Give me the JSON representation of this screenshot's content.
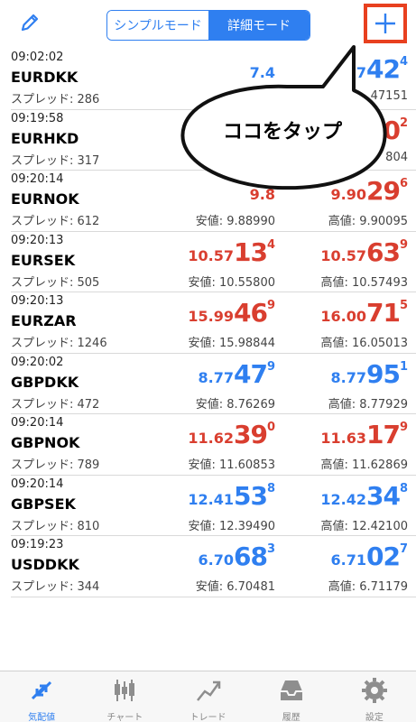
{
  "header": {
    "edit_icon": "pencil-icon",
    "mode_simple": "シンプルモード",
    "mode_detailed": "詳細モード",
    "add_icon": "plus-icon"
  },
  "callout": "ココをタップ",
  "quotes": [
    {
      "time": "09:02:02",
      "symbol": "EURDKK",
      "spread": "スプレッド: 286",
      "bid": {
        "small": "7.4",
        "big": "",
        "sup": "",
        "color": "blue"
      },
      "ask": {
        "small": "7",
        "big": "42",
        "sup": "4",
        "color": "blue"
      },
      "low": "",
      "high": "47151"
    },
    {
      "time": "09:19:58",
      "symbol": "EURHKD",
      "spread": "スプレッド: 317",
      "bid": {
        "small": "",
        "big": "",
        "sup": "",
        "color": "blue"
      },
      "ask": {
        "small": "",
        "big": "0",
        "sup": "2",
        "color": "red"
      },
      "low": "",
      "high": "804"
    },
    {
      "time": "09:20:14",
      "symbol": "EURNOK",
      "spread": "スプレッド: 612",
      "bid": {
        "small": "9.8",
        "big": "",
        "sup": "",
        "color": "red"
      },
      "ask": {
        "small": "9.90",
        "big": "29",
        "sup": "6",
        "color": "red"
      },
      "low": "安値: 9.88990",
      "high": "高値: 9.90095"
    },
    {
      "time": "09:20:13",
      "symbol": "EURSEK",
      "spread": "スプレッド: 505",
      "bid": {
        "small": "10.57",
        "big": "13",
        "sup": "4",
        "color": "red"
      },
      "ask": {
        "small": "10.57",
        "big": "63",
        "sup": "9",
        "color": "red"
      },
      "low": "安値: 10.55800",
      "high": "高値: 10.57493"
    },
    {
      "time": "09:20:13",
      "symbol": "EURZAR",
      "spread": "スプレッド: 1246",
      "bid": {
        "small": "15.99",
        "big": "46",
        "sup": "9",
        "color": "red"
      },
      "ask": {
        "small": "16.00",
        "big": "71",
        "sup": "5",
        "color": "red"
      },
      "low": "安値: 15.98844",
      "high": "高値: 16.05013"
    },
    {
      "time": "09:20:02",
      "symbol": "GBPDKK",
      "spread": "スプレッド: 472",
      "bid": {
        "small": "8.77",
        "big": "47",
        "sup": "9",
        "color": "blue"
      },
      "ask": {
        "small": "8.77",
        "big": "95",
        "sup": "1",
        "color": "blue"
      },
      "low": "安値: 8.76269",
      "high": "高値: 8.77929"
    },
    {
      "time": "09:20:14",
      "symbol": "GBPNOK",
      "spread": "スプレッド: 789",
      "bid": {
        "small": "11.62",
        "big": "39",
        "sup": "0",
        "color": "red"
      },
      "ask": {
        "small": "11.63",
        "big": "17",
        "sup": "9",
        "color": "red"
      },
      "low": "安値: 11.60853",
      "high": "高値: 11.62869"
    },
    {
      "time": "09:20:14",
      "symbol": "GBPSEK",
      "spread": "スプレッド: 810",
      "bid": {
        "small": "12.41",
        "big": "53",
        "sup": "8",
        "color": "blue"
      },
      "ask": {
        "small": "12.42",
        "big": "34",
        "sup": "8",
        "color": "blue"
      },
      "low": "安値: 12.39490",
      "high": "高値: 12.42100"
    },
    {
      "time": "09:19:23",
      "symbol": "USDDKK",
      "spread": "スプレッド: 344",
      "bid": {
        "small": "6.70",
        "big": "68",
        "sup": "3",
        "color": "blue"
      },
      "ask": {
        "small": "6.71",
        "big": "02",
        "sup": "7",
        "color": "blue"
      },
      "low": "安値: 6.70481",
      "high": "高値: 6.71179"
    }
  ],
  "tabs": [
    {
      "label": "気配値",
      "icon": "quotes-arrows-icon",
      "active": true
    },
    {
      "label": "チャート",
      "icon": "candlestick-chart-icon",
      "active": false
    },
    {
      "label": "トレード",
      "icon": "trade-trend-icon",
      "active": false
    },
    {
      "label": "履歴",
      "icon": "history-inbox-icon",
      "active": false
    },
    {
      "label": "設定",
      "icon": "settings-gear-icon",
      "active": false
    }
  ],
  "colors": {
    "accent": "#2f7ff0",
    "up": "#d93e2f",
    "highlight": "#e8401f"
  }
}
